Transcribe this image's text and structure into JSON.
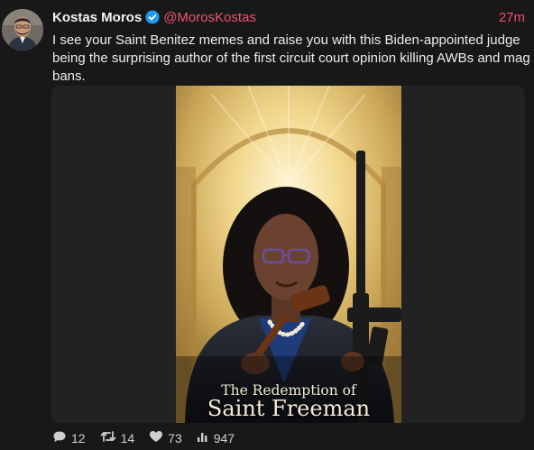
{
  "tweet": {
    "author": {
      "name": "Kostas Moros",
      "handle": "@MorosKostas"
    },
    "time": "27m",
    "text": "I see your Saint Benitez memes and raise you with this Biden-appointed judge being the surprising author of the first circuit court opinion killing AWBs and mag bans.",
    "media": {
      "caption_line1": "The Redemption of",
      "caption_line2": "Saint Freeman"
    },
    "stats": {
      "replies": "12",
      "retweets": "14",
      "likes": "73",
      "views": "947"
    }
  },
  "colors": {
    "accent": "#f0506e",
    "verified": "#1d9bf0",
    "background": "#181818"
  },
  "icons": [
    "verified-badge-icon",
    "reply-icon",
    "retweet-icon",
    "like-icon",
    "views-icon"
  ]
}
